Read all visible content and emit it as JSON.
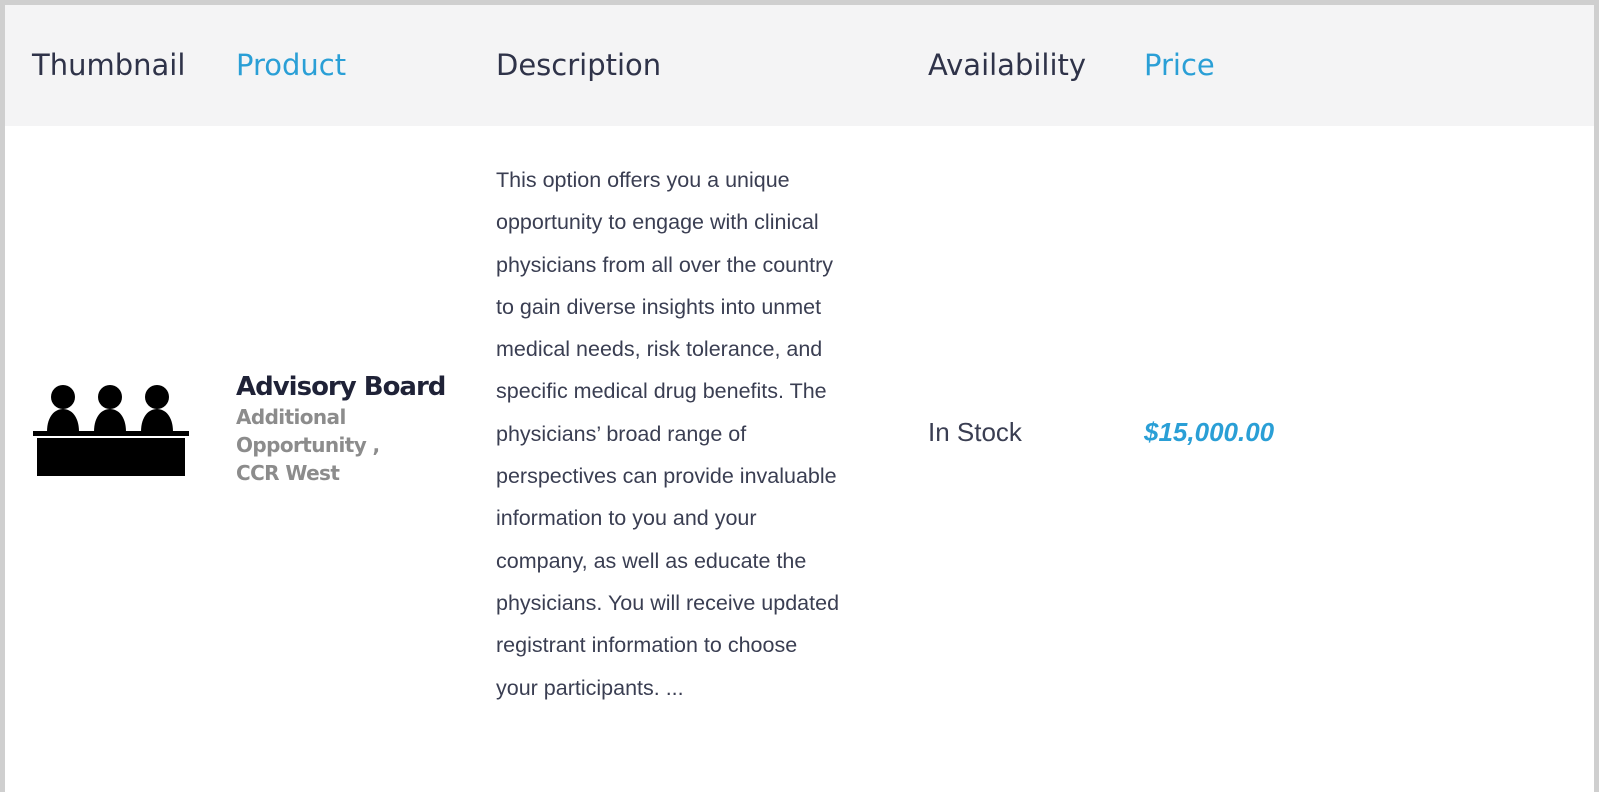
{
  "table": {
    "columns": {
      "thumbnail": "Thumbnail",
      "product": "Product",
      "description": "Description",
      "availability": "Availability",
      "price": "Price"
    },
    "rows": [
      {
        "thumbnail_icon": "advisory-board-icon",
        "product_name": "Advisory Board",
        "product_categories": "Additional Opportunity , CCR West",
        "description": "This option offers you a unique\nopportunity to engage with clinical\nphysicians from all over the country\nto gain diverse insights into unmet\nmedical needs, risk tolerance, and\nspecific medical drug benefits.  The\nphysicians’ broad range of\nperspectives can provide invaluable\ninformation to you and your\ncompany, as well as educate the\nphysicians.  You will receive updated\nregistrant information to choose\nyour participants. ...",
        "availability": "In Stock",
        "price": "$15,000.00"
      }
    ]
  },
  "colors": {
    "accent": "#2a9fd6",
    "header_bg": "#f4f4f5",
    "text": "#3a3e52",
    "muted": "#8c8c8c"
  }
}
